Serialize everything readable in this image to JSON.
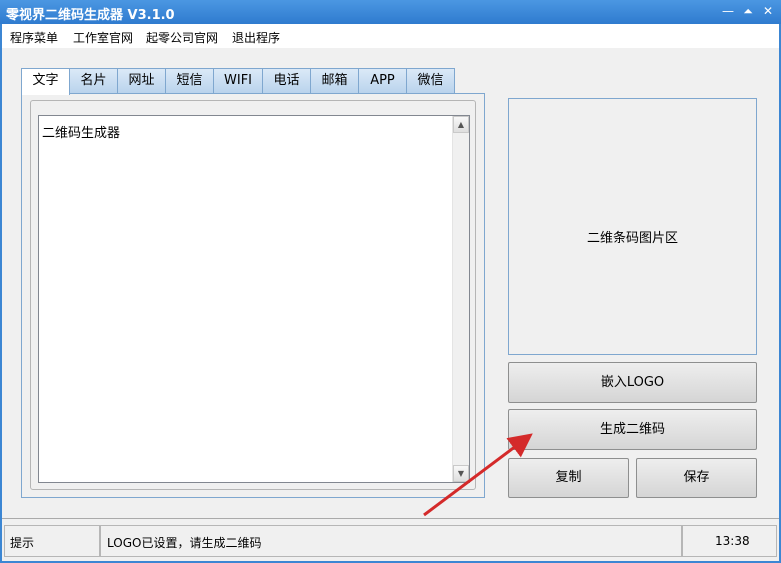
{
  "window": {
    "title": "零视界二维码生成器 V3.1.0"
  },
  "controls": {
    "minimize": "—",
    "restore": "⏶",
    "close": "✕"
  },
  "menu": {
    "items": [
      {
        "label": "程序菜单"
      },
      {
        "label": "工作室官网"
      },
      {
        "label": "起零公司官网"
      },
      {
        "label": "退出程序"
      }
    ]
  },
  "tabs": [
    {
      "label": "文字",
      "active": true
    },
    {
      "label": "名片"
    },
    {
      "label": "网址"
    },
    {
      "label": "短信"
    },
    {
      "label": "WIFI"
    },
    {
      "label": "电话"
    },
    {
      "label": "邮箱"
    },
    {
      "label": "APP"
    },
    {
      "label": "微信"
    }
  ],
  "editor": {
    "value": "二维码生成器"
  },
  "preview": {
    "label": "二维条码图片区"
  },
  "buttons": {
    "embed_logo": "嵌入LOGO",
    "generate": "生成二维码",
    "copy": "复制",
    "save": "保存"
  },
  "status": {
    "hint_label": "提示",
    "message": "LOGO已设置，请生成二维码",
    "time": "13:38"
  },
  "colors": {
    "title_bar": "#3c86d3",
    "annotation_arrow": "#d42a2a"
  }
}
